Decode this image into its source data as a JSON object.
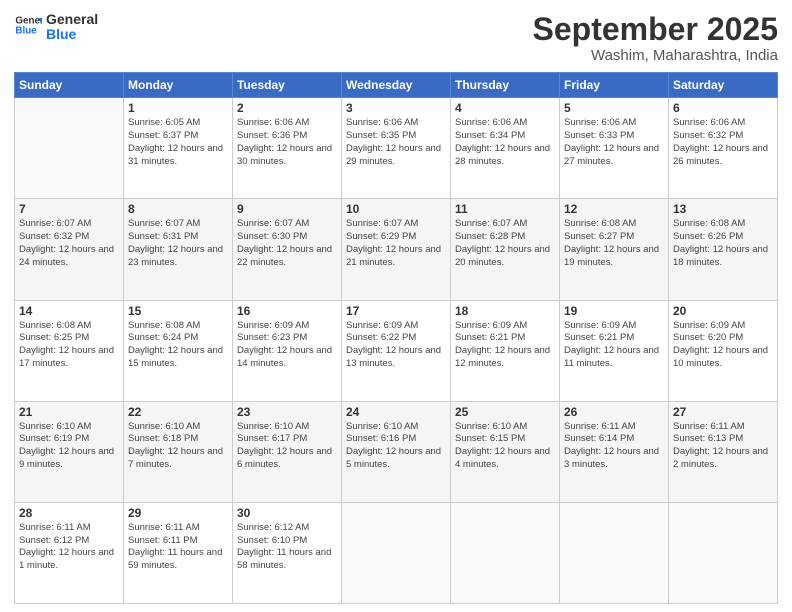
{
  "header": {
    "logo_line1": "General",
    "logo_line2": "Blue",
    "month_year": "September 2025",
    "location": "Washim, Maharashtra, India"
  },
  "weekdays": [
    "Sunday",
    "Monday",
    "Tuesday",
    "Wednesday",
    "Thursday",
    "Friday",
    "Saturday"
  ],
  "weeks": [
    [
      {
        "day": "",
        "info": ""
      },
      {
        "day": "1",
        "info": "Sunrise: 6:05 AM\nSunset: 6:37 PM\nDaylight: 12 hours\nand 31 minutes."
      },
      {
        "day": "2",
        "info": "Sunrise: 6:06 AM\nSunset: 6:36 PM\nDaylight: 12 hours\nand 30 minutes."
      },
      {
        "day": "3",
        "info": "Sunrise: 6:06 AM\nSunset: 6:35 PM\nDaylight: 12 hours\nand 29 minutes."
      },
      {
        "day": "4",
        "info": "Sunrise: 6:06 AM\nSunset: 6:34 PM\nDaylight: 12 hours\nand 28 minutes."
      },
      {
        "day": "5",
        "info": "Sunrise: 6:06 AM\nSunset: 6:33 PM\nDaylight: 12 hours\nand 27 minutes."
      },
      {
        "day": "6",
        "info": "Sunrise: 6:06 AM\nSunset: 6:32 PM\nDaylight: 12 hours\nand 26 minutes."
      }
    ],
    [
      {
        "day": "7",
        "info": "Sunrise: 6:07 AM\nSunset: 6:32 PM\nDaylight: 12 hours\nand 24 minutes."
      },
      {
        "day": "8",
        "info": "Sunrise: 6:07 AM\nSunset: 6:31 PM\nDaylight: 12 hours\nand 23 minutes."
      },
      {
        "day": "9",
        "info": "Sunrise: 6:07 AM\nSunset: 6:30 PM\nDaylight: 12 hours\nand 22 minutes."
      },
      {
        "day": "10",
        "info": "Sunrise: 6:07 AM\nSunset: 6:29 PM\nDaylight: 12 hours\nand 21 minutes."
      },
      {
        "day": "11",
        "info": "Sunrise: 6:07 AM\nSunset: 6:28 PM\nDaylight: 12 hours\nand 20 minutes."
      },
      {
        "day": "12",
        "info": "Sunrise: 6:08 AM\nSunset: 6:27 PM\nDaylight: 12 hours\nand 19 minutes."
      },
      {
        "day": "13",
        "info": "Sunrise: 6:08 AM\nSunset: 6:26 PM\nDaylight: 12 hours\nand 18 minutes."
      }
    ],
    [
      {
        "day": "14",
        "info": "Sunrise: 6:08 AM\nSunset: 6:25 PM\nDaylight: 12 hours\nand 17 minutes."
      },
      {
        "day": "15",
        "info": "Sunrise: 6:08 AM\nSunset: 6:24 PM\nDaylight: 12 hours\nand 15 minutes."
      },
      {
        "day": "16",
        "info": "Sunrise: 6:09 AM\nSunset: 6:23 PM\nDaylight: 12 hours\nand 14 minutes."
      },
      {
        "day": "17",
        "info": "Sunrise: 6:09 AM\nSunset: 6:22 PM\nDaylight: 12 hours\nand 13 minutes."
      },
      {
        "day": "18",
        "info": "Sunrise: 6:09 AM\nSunset: 6:21 PM\nDaylight: 12 hours\nand 12 minutes."
      },
      {
        "day": "19",
        "info": "Sunrise: 6:09 AM\nSunset: 6:21 PM\nDaylight: 12 hours\nand 11 minutes."
      },
      {
        "day": "20",
        "info": "Sunrise: 6:09 AM\nSunset: 6:20 PM\nDaylight: 12 hours\nand 10 minutes."
      }
    ],
    [
      {
        "day": "21",
        "info": "Sunrise: 6:10 AM\nSunset: 6:19 PM\nDaylight: 12 hours\nand 9 minutes."
      },
      {
        "day": "22",
        "info": "Sunrise: 6:10 AM\nSunset: 6:18 PM\nDaylight: 12 hours\nand 7 minutes."
      },
      {
        "day": "23",
        "info": "Sunrise: 6:10 AM\nSunset: 6:17 PM\nDaylight: 12 hours\nand 6 minutes."
      },
      {
        "day": "24",
        "info": "Sunrise: 6:10 AM\nSunset: 6:16 PM\nDaylight: 12 hours\nand 5 minutes."
      },
      {
        "day": "25",
        "info": "Sunrise: 6:10 AM\nSunset: 6:15 PM\nDaylight: 12 hours\nand 4 minutes."
      },
      {
        "day": "26",
        "info": "Sunrise: 6:11 AM\nSunset: 6:14 PM\nDaylight: 12 hours\nand 3 minutes."
      },
      {
        "day": "27",
        "info": "Sunrise: 6:11 AM\nSunset: 6:13 PM\nDaylight: 12 hours\nand 2 minutes."
      }
    ],
    [
      {
        "day": "28",
        "info": "Sunrise: 6:11 AM\nSunset: 6:12 PM\nDaylight: 12 hours\nand 1 minute."
      },
      {
        "day": "29",
        "info": "Sunrise: 6:11 AM\nSunset: 6:11 PM\nDaylight: 11 hours\nand 59 minutes."
      },
      {
        "day": "30",
        "info": "Sunrise: 6:12 AM\nSunset: 6:10 PM\nDaylight: 11 hours\nand 58 minutes."
      },
      {
        "day": "",
        "info": ""
      },
      {
        "day": "",
        "info": ""
      },
      {
        "day": "",
        "info": ""
      },
      {
        "day": "",
        "info": ""
      }
    ]
  ]
}
